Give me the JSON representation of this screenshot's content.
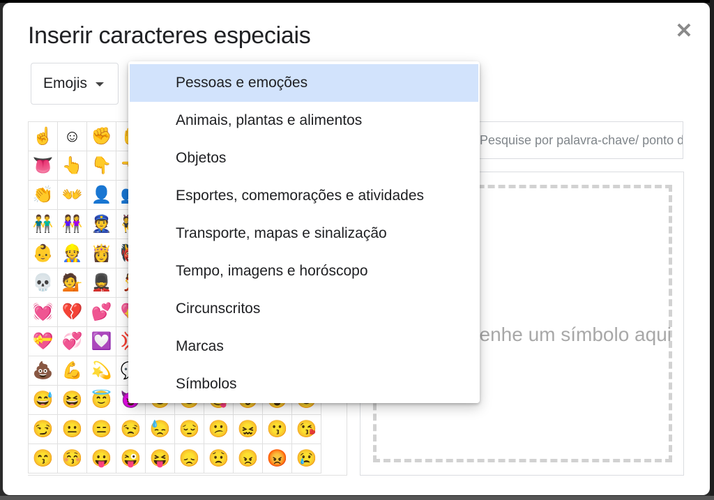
{
  "dialog": {
    "title": "Inserir caracteres especiais",
    "close_icon": "✕"
  },
  "category_select": {
    "value": "Emojis"
  },
  "search": {
    "placeholder": "Pesquise por palavra-chave/ ponto de código"
  },
  "draw_area": {
    "hint": "Desenhe um símbolo aqui"
  },
  "dropdown": {
    "selected_index": 0,
    "options": [
      "Pessoas e emoções",
      "Animais, plantas e alimentos",
      "Objetos",
      "Esportes, comemorações e atividades",
      "Transporte, mapas e sinalização",
      "Tempo, imagens e horóscopo",
      "Circunscritos",
      "Marcas",
      "Símbolos"
    ]
  },
  "emoji_grid": [
    [
      "☝",
      "☺",
      "✊",
      "✋",
      "✌",
      "✍",
      "👀",
      "👂",
      "👃",
      "👄"
    ],
    [
      "👅",
      "👆",
      "👇",
      "👈",
      "👉",
      "👊",
      "👋",
      "👌",
      "👍",
      "👎"
    ],
    [
      "👏",
      "👐",
      "👤",
      "👥",
      "👦",
      "👧",
      "👨",
      "👩",
      "👪",
      "👫"
    ],
    [
      "👬",
      "👭",
      "👮",
      "👯",
      "👰",
      "👱",
      "👲",
      "👳",
      "👴",
      "👵"
    ],
    [
      "👶",
      "👷",
      "👸",
      "👹",
      "👺",
      "👻",
      "👼",
      "👽",
      "👾",
      "👿"
    ],
    [
      "💀",
      "💁",
      "💂",
      "💃",
      "💅",
      "💆",
      "💇",
      "💋",
      "💌",
      "💓"
    ],
    [
      "💓",
      "💔",
      "💕",
      "💖",
      "💗",
      "💘",
      "💙",
      "💚",
      "💛",
      "💜"
    ],
    [
      "💝",
      "💞",
      "💟",
      "💢",
      "💤",
      "💥",
      "💦",
      "💧",
      "💨",
      "💩"
    ],
    [
      "💩",
      "💪",
      "💫",
      "💬",
      "💭",
      "😀",
      "😁",
      "😂",
      "😃",
      "😄"
    ],
    [
      "😅",
      "😆",
      "😇",
      "😈",
      "😉",
      "😊",
      "😋",
      "😌",
      "😍",
      "😎"
    ],
    [
      "😏",
      "😐",
      "😑",
      "😒",
      "😓",
      "😔",
      "😕",
      "😖",
      "😗",
      "😘"
    ],
    [
      "😙",
      "😚",
      "😛",
      "😜",
      "😝",
      "😞",
      "😟",
      "😠",
      "😡",
      "😢"
    ]
  ]
}
